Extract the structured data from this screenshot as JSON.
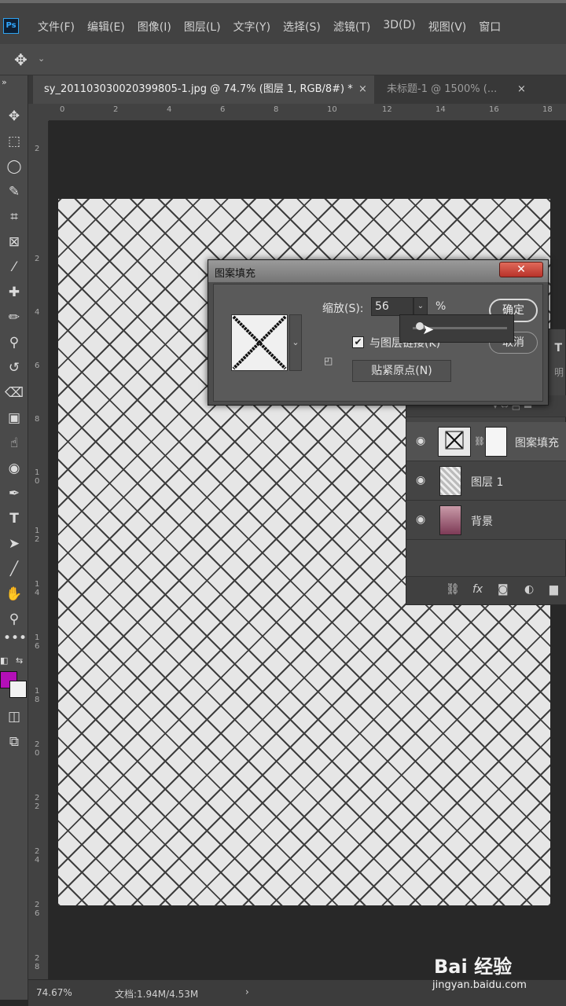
{
  "app": {
    "logo": "Ps"
  },
  "menu": [
    "文件(F)",
    "编辑(E)",
    "图像(I)",
    "图层(L)",
    "文字(Y)",
    "选择(S)",
    "滤镜(T)",
    "3D(D)",
    "视图(V)",
    "窗口"
  ],
  "tabs": [
    {
      "label": "sy_20110303002039​9805-1.jpg @ 74.7% (图层 1, RGB/8#) *",
      "close": "×"
    },
    {
      "label": "未标题-1 @ 1500% (...",
      "close": "×"
    }
  ],
  "ruler": {
    "top": [
      "0",
      "2",
      "4",
      "6",
      "8",
      "10",
      "12",
      "14",
      "16",
      "18"
    ],
    "left": [
      "2",
      "2",
      "4",
      "6",
      "8",
      "1 0",
      "1 2",
      "1 4",
      "1 6",
      "1 8",
      "2 0",
      "2 2",
      "2 4",
      "2 6",
      "2 8"
    ]
  },
  "dialog": {
    "title": "图案填充",
    "close": "✕",
    "scale_label": "缩放(S):",
    "scale_value": "56",
    "scale_unit": "%",
    "link_label": "与图层链接(K)",
    "snap_button": "贴紧原点(N)",
    "ok": "确定",
    "cancel": "取消"
  },
  "layers": [
    {
      "name": "图案填充",
      "selected": true
    },
    {
      "name": "图层 1",
      "selected": false
    },
    {
      "name": "背景",
      "selected": false
    }
  ],
  "status": {
    "zoom": "74.67%",
    "doc": "文档:1.94M/4.53M",
    "arrow": "›"
  },
  "watermark": {
    "logo": "Bai 经验",
    "sub": "jingyan.baidu.com"
  },
  "colors": {
    "foreground": "#b30fb7",
    "background": "#f2f2f2"
  },
  "icons": [
    "move-icon",
    "marquee-icon",
    "lasso-icon",
    "quick-select-icon",
    "crop-icon",
    "frame-icon",
    "eyedropper-icon",
    "healing-icon",
    "brush-icon",
    "stamp-icon",
    "history-brush-icon",
    "eraser-icon",
    "gradient-icon",
    "smudge-icon",
    "sponge-icon",
    "pen-icon",
    "type-icon",
    "path-select-icon",
    "line-icon",
    "hand-icon",
    "zoom-icon",
    "more-icon"
  ]
}
